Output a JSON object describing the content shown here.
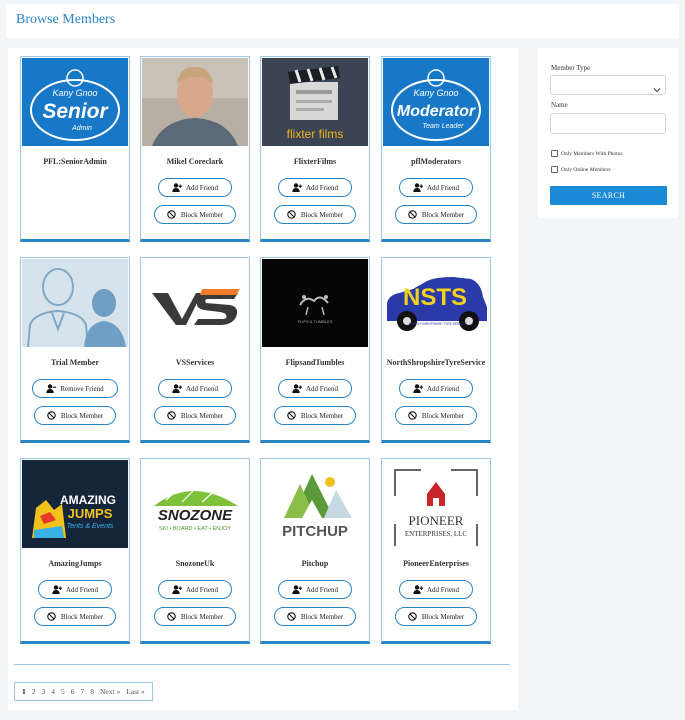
{
  "header": {
    "title": "Browse Members"
  },
  "members": [
    {
      "name": "PFL:SeniorAdmin",
      "buttons": []
    },
    {
      "name": "Mikel Coreclark",
      "buttons": [
        "Add Friend",
        "Block Member"
      ]
    },
    {
      "name": "FlixterFilms",
      "buttons": [
        "Add Friend",
        "Block Member"
      ]
    },
    {
      "name": "pflModerators",
      "buttons": [
        "Add Friend",
        "Block Member"
      ]
    },
    {
      "name": "Trial Member",
      "buttons": [
        "Remove Friend",
        "Block Member"
      ]
    },
    {
      "name": "VSServices",
      "buttons": [
        "Add Friend",
        "Block Member"
      ]
    },
    {
      "name": "FlipsandTumbles",
      "buttons": [
        "Add Friend",
        "Block Member"
      ]
    },
    {
      "name": "NorthShropshireTyreService",
      "buttons": [
        "Add Friend",
        "Block Member"
      ]
    },
    {
      "name": "AmazingJumps",
      "buttons": [
        "Add Friend",
        "Block Member"
      ]
    },
    {
      "name": "SnozoneUk",
      "buttons": [
        "Add Friend",
        "Block Member"
      ]
    },
    {
      "name": "Pitchup",
      "buttons": [
        "Add Friend",
        "Block Member"
      ]
    },
    {
      "name": "PioneerEnterprises",
      "buttons": [
        "Add Friend",
        "Block Member"
      ]
    }
  ],
  "logos": {
    "senior": {
      "line1": "Kany Gnoo",
      "line2": "Senior",
      "line3": "Admin"
    },
    "moderator": {
      "line1": "Kany Gnoo",
      "line2": "Moderator",
      "line3": "Team Leader"
    },
    "flixter": {
      "text": "flixter films"
    },
    "flips": {
      "text": "FLIPS & TUMBLES"
    },
    "nsts": {
      "text": "NSTS",
      "sub": "NORTH SHROPSHIRE TYRE SERVICE"
    },
    "amazing": {
      "line1": "AMAZING",
      "line2": "JUMPS",
      "line3": "Tents & Events"
    },
    "snozone": {
      "text": "SNOZONE",
      "sub": "SKI • BOARD • EAT • ENJOY"
    },
    "pitchup": {
      "text": "PITCHUP"
    },
    "pioneer": {
      "line1": "PIONEER",
      "line2": "ENTERPRISES, LLC"
    }
  },
  "pagination": {
    "pages": [
      "1",
      "2",
      "3",
      "4",
      "5",
      "6",
      "7",
      "8"
    ],
    "next": "Next »",
    "last": "Last »",
    "current": "1"
  },
  "filters": {
    "member_type_label": "Member Type",
    "member_type_value": "",
    "name_label": "Name",
    "name_value": "",
    "only_photos_label": "Only Members With Photos",
    "only_online_label": "Only Online Members",
    "search_label": "SEARCH"
  },
  "colors": {
    "accent": "#2b86c8",
    "button_primary": "#1a8ad6"
  }
}
